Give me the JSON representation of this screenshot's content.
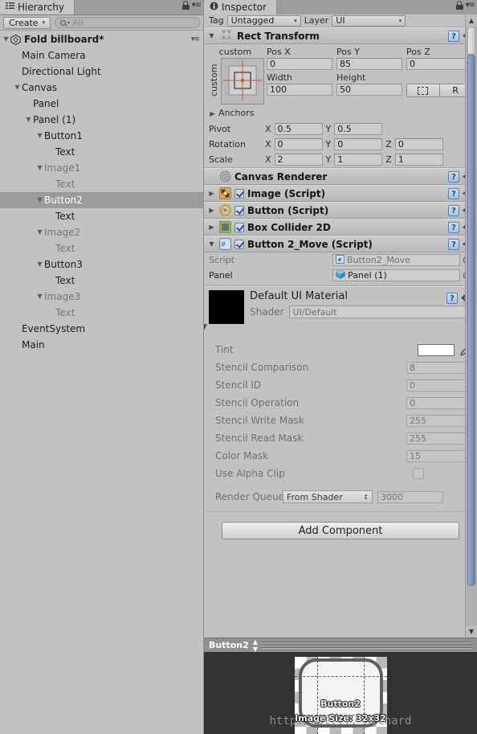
{
  "hierarchy": {
    "tab_label": "Hierarchy",
    "tab_icon": "hierarchy-icon",
    "lock_icon": "lock-icon",
    "menu_icon": "panel-menu-icon",
    "toolbar": {
      "create_label": "Create",
      "create_caret": "▾",
      "search_placeholder": "All",
      "search_value": "",
      "search_icon": "search-icon"
    },
    "scene": {
      "name": "Fold billboard*",
      "foldout": "▼",
      "icon": "unity-scene-icon",
      "menu": "▾≡"
    },
    "items": [
      {
        "label": "Main Camera",
        "indent": 1,
        "foldout": "",
        "dim": false
      },
      {
        "label": "Directional Light",
        "indent": 1,
        "foldout": "",
        "dim": false
      },
      {
        "label": "Canvas",
        "indent": 1,
        "foldout": "▼",
        "dim": false
      },
      {
        "label": "Panel",
        "indent": 2,
        "foldout": "",
        "dim": false
      },
      {
        "label": "Panel (1)",
        "indent": 2,
        "foldout": "▼",
        "dim": false
      },
      {
        "label": "Button1",
        "indent": 3,
        "foldout": "▼",
        "dim": false
      },
      {
        "label": "Text",
        "indent": 4,
        "foldout": "",
        "dim": false
      },
      {
        "label": "Image1",
        "indent": 3,
        "foldout": "▼",
        "dim": true
      },
      {
        "label": "Text",
        "indent": 4,
        "foldout": "",
        "dim": true
      },
      {
        "label": "Button2",
        "indent": 3,
        "foldout": "▼",
        "dim": false,
        "selected": true
      },
      {
        "label": "Text",
        "indent": 4,
        "foldout": "",
        "dim": false
      },
      {
        "label": "Image2",
        "indent": 3,
        "foldout": "▼",
        "dim": true
      },
      {
        "label": "Text",
        "indent": 4,
        "foldout": "",
        "dim": true
      },
      {
        "label": "Button3",
        "indent": 3,
        "foldout": "▼",
        "dim": false
      },
      {
        "label": "Text",
        "indent": 4,
        "foldout": "",
        "dim": false
      },
      {
        "label": "Image3",
        "indent": 3,
        "foldout": "▼",
        "dim": true
      },
      {
        "label": "Text",
        "indent": 4,
        "foldout": "",
        "dim": true
      },
      {
        "label": "EventSystem",
        "indent": 1,
        "foldout": "",
        "dim": false
      },
      {
        "label": "Main",
        "indent": 1,
        "foldout": "",
        "dim": false
      }
    ]
  },
  "inspector": {
    "tab_label": "Inspector",
    "tab_icon": "info-icon",
    "lock_icon": "lock-icon",
    "menu_icon": "panel-menu-icon",
    "tag_layer": {
      "tag_label": "Tag",
      "tag_value": "Untagged",
      "layer_label": "Layer",
      "layer_value": "UI",
      "caret": "▾"
    },
    "rect_transform": {
      "title": "Rect Transform",
      "foldout": "▼",
      "icon": "rect-transform-icon",
      "help_icon": "help-icon",
      "gear_icon": "gear-icon",
      "anchor_preset_top": "custom",
      "anchor_preset_side": "custom",
      "pos_x_label": "Pos X",
      "pos_x": "0",
      "pos_y_label": "Pos Y",
      "pos_y": "85",
      "pos_z_label": "Pos Z",
      "pos_z": "0",
      "width_label": "Width",
      "width": "100",
      "height_label": "Height",
      "height": "50",
      "blueprint_label": "blueprint-mode-icon",
      "raw_label": "R",
      "anchors_label": "Anchors",
      "anchors_foldout": "▶",
      "pivot_label": "Pivot",
      "pivot_x": "0.5",
      "pivot_y": "0.5",
      "rotation_label": "Rotation",
      "rot_x": "0",
      "rot_y": "0",
      "rot_z": "0",
      "scale_label": "Scale",
      "scale_x": "2",
      "scale_y": "1",
      "scale_z": "1",
      "axis_x": "X",
      "axis_y": "Y",
      "axis_z": "Z"
    },
    "components": [
      {
        "title": "Canvas Renderer",
        "icon": "canvas-renderer-icon",
        "foldout": "",
        "has_checkbox": false,
        "checked": false
      },
      {
        "title": "Image (Script)",
        "icon": "image-script-icon",
        "foldout": "▶",
        "has_checkbox": true,
        "checked": true
      },
      {
        "title": "Button (Script)",
        "icon": "button-script-icon",
        "foldout": "▶",
        "has_checkbox": true,
        "checked": true
      },
      {
        "title": "Box Collider 2D",
        "icon": "box-collider-2d-icon",
        "foldout": "▶",
        "has_checkbox": true,
        "checked": true
      },
      {
        "title": "Button 2_Move (Script)",
        "icon": "cs-script-icon",
        "foldout": "▼",
        "has_checkbox": true,
        "checked": true
      }
    ],
    "button2_move": {
      "script_label": "Script",
      "script_value": "Button2_Move",
      "script_icon": "cs-script-icon",
      "panel_label": "Panel",
      "panel_value": "Panel (1)",
      "panel_icon": "prefab-cube-icon",
      "picker_icon": "object-picker-icon"
    },
    "material": {
      "name": "Default UI Material",
      "foldout": "▼",
      "swatch_color": "#000000",
      "shader_label": "Shader",
      "shader_value": "UI/Default",
      "shader_caret": "▾",
      "help_icon": "help-icon",
      "gear_icon": "gear-icon",
      "properties": [
        {
          "label": "Tint",
          "type": "color",
          "value": "#FFFFFF"
        },
        {
          "label": "Stencil Comparison",
          "type": "number",
          "value": "8"
        },
        {
          "label": "Stencil ID",
          "type": "number",
          "value": "0"
        },
        {
          "label": "Stencil Operation",
          "type": "number",
          "value": "0"
        },
        {
          "label": "Stencil Write Mask",
          "type": "number",
          "value": "255"
        },
        {
          "label": "Stencil Read Mask",
          "type": "number",
          "value": "255"
        },
        {
          "label": "Color Mask",
          "type": "number",
          "value": "15"
        },
        {
          "label": "Use Alpha Clip",
          "type": "checkbox",
          "value": ""
        }
      ],
      "render_queue_label": "Render Queue",
      "render_queue_mode": "From Shader",
      "render_queue_caret": "↕",
      "render_queue_value": "3000",
      "eyedropper_icon": "eyedropper-icon"
    },
    "add_component_label": "Add Component",
    "scrollbar": {
      "up_arrow": "▲",
      "down_arrow": "▼"
    }
  },
  "preview": {
    "title": "Button2",
    "updown_icon": "updown-arrows-icon",
    "sprite_label": "Button2",
    "size_label": "Image Size: 32x32",
    "watermark": "http://bl...._Richard"
  }
}
